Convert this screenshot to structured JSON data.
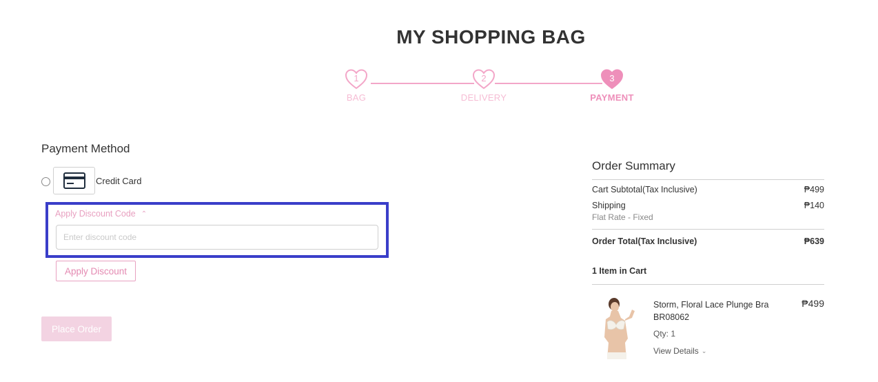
{
  "page_title": "MY SHOPPING BAG",
  "colors": {
    "accent_pink": "#ee8fba",
    "light_pink": "#f6bcd4",
    "highlight_border": "#3a3ec9",
    "place_order_bg": "#f3d3e2"
  },
  "stepper": {
    "steps": [
      {
        "number": "1",
        "label": "BAG",
        "active": false
      },
      {
        "number": "2",
        "label": "DELIVERY",
        "active": false
      },
      {
        "number": "3",
        "label": "PAYMENT",
        "active": true
      }
    ]
  },
  "payment": {
    "section_title": "Payment Method",
    "option_label": "Credit Card",
    "option_icon": "credit-card-icon",
    "discount_toggle_label": "Apply Discount Code",
    "discount_placeholder": "Enter discount code",
    "discount_value": "",
    "apply_button": "Apply Discount",
    "place_order_button": "Place Order"
  },
  "summary": {
    "title": "Order Summary",
    "subtotal_label": "Cart Subtotal(Tax Inclusive)",
    "subtotal_value": "₱499",
    "shipping_label": "Shipping",
    "shipping_method": "Flat Rate - Fixed",
    "shipping_value": "₱140",
    "total_label": "Order Total(Tax Inclusive)",
    "total_value": "₱639",
    "items_count": "1 Item in Cart",
    "items": [
      {
        "name": "Storm, Floral Lace Plunge Bra BR08062",
        "price": "₱499",
        "qty": "Qty: 1",
        "details_link": "View Details"
      }
    ]
  }
}
